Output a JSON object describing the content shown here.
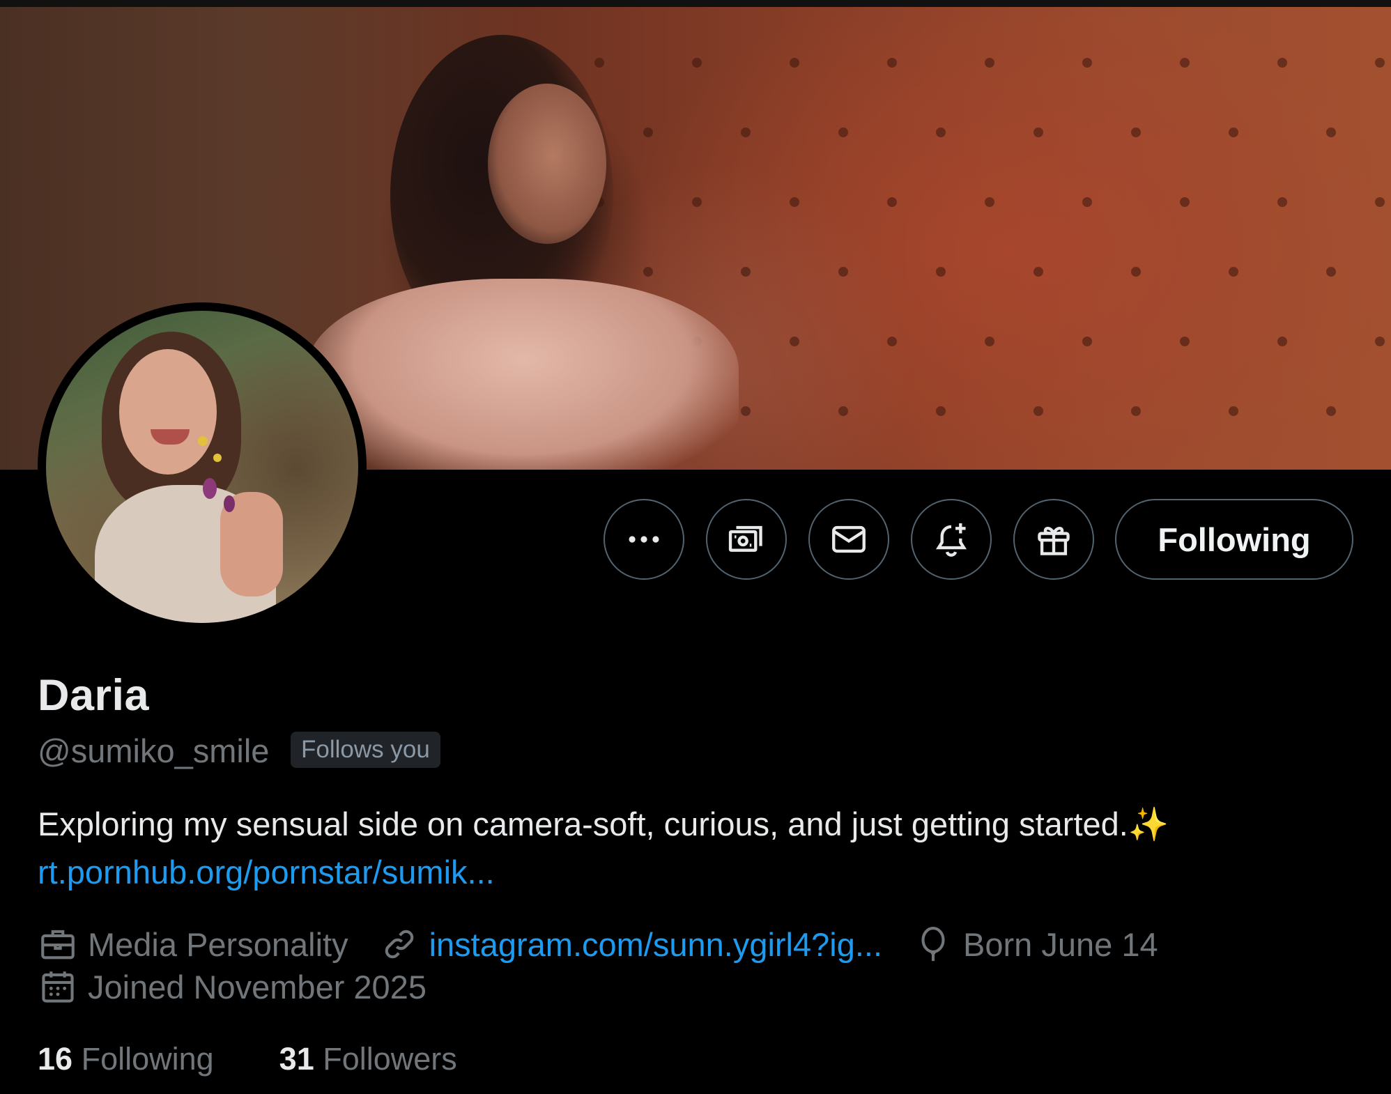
{
  "profile": {
    "display_name": "Daria",
    "handle": "@sumiko_smile",
    "follows_you_badge": "Follows you",
    "bio": "Exploring my sensual side on camera-soft, curious, and just getting started.",
    "bio_emoji": "✨",
    "bio_link": "rt.pornhub.org/pornstar/sumik...",
    "category": "Media Personality",
    "website": "instagram.com/sunn.ygirl4?ig...",
    "birthday": "Born June 14",
    "joined": "Joined November 2025"
  },
  "stats": {
    "following_count": "16",
    "following_label": "Following",
    "followers_count": "31",
    "followers_label": "Followers"
  },
  "actions": {
    "follow_button_label": "Following",
    "more_icon": "more-horizontal-icon",
    "tip_icon": "money-icon",
    "message_icon": "envelope-icon",
    "notify_icon": "bell-plus-icon",
    "gift_icon": "gift-icon"
  },
  "colors": {
    "background": "#000000",
    "link": "#1d9bf0",
    "secondary_text": "#71767b",
    "button_border": "#536471"
  }
}
